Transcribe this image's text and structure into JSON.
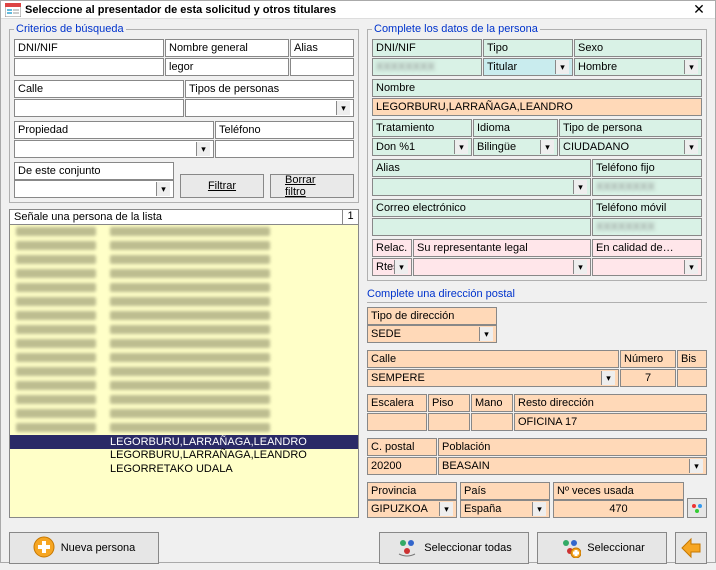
{
  "window": {
    "title": "Seleccione al presentador de esta solicitud y otros titulares"
  },
  "search": {
    "legend": "Criterios de búsqueda",
    "dni_lbl": "DNI/NIF",
    "dni_val": "",
    "nombre_lbl": "Nombre general",
    "nombre_val": "legor",
    "alias_lbl": "Alias",
    "alias_val": "",
    "calle_lbl": "Calle",
    "calle_val": "",
    "tipos_lbl": "Tipos de personas",
    "tipos_val": "",
    "propiedad_lbl": "Propiedad",
    "propiedad_val": "",
    "telefono_lbl": "Teléfono",
    "telefono_val": "",
    "conjunto_lbl": "De este conjunto",
    "conjunto_val": "",
    "filtrar": "Filtrar",
    "borrar": "Borrar filtro"
  },
  "list": {
    "header": "Señale una persona de la lista",
    "count": "1",
    "selected": "LEGORBURU,LARRAÑAGA,LEANDRO",
    "row2": "LEGORBURU,LARRAÑAGA,LEANDRO",
    "row3": "LEGORRETAKO UDALA"
  },
  "persona": {
    "legend": "Complete los datos de la persona",
    "dni_lbl": "DNI/NIF",
    "dni_val": "XXXXXXXX",
    "tipo_lbl": "Tipo",
    "tipo_val": "Titular",
    "sexo_lbl": "Sexo",
    "sexo_val": "Hombre",
    "nombre_lbl": "Nombre",
    "nombre_val": "LEGORBURU,LARRAÑAGA,LEANDRO",
    "trat_lbl": "Tratamiento",
    "trat_val": "Don %1",
    "idioma_lbl": "Idioma",
    "idioma_val": "Bilingüe",
    "tipop_lbl": "Tipo de persona",
    "tipop_val": "CIUDADANO",
    "alias_lbl": "Alias",
    "alias_val": "",
    "telf_lbl": "Teléfono fijo",
    "telf_val": "XXXXXXXX",
    "email_lbl": "Correo electrónico",
    "email_val": "",
    "telm_lbl": "Teléfono móvil",
    "telm_val": "XXXXXXXX",
    "relac_lbl": "Relac. Rtes.",
    "relac_val": "",
    "repr_lbl": "Su representante legal",
    "repr_val": "",
    "calidad_lbl": "En calidad de…",
    "calidad_val": ""
  },
  "direccion": {
    "header": "Complete una dirección postal",
    "tipo_lbl": "Tipo de dirección",
    "tipo_val": "SEDE",
    "calle_lbl": "Calle",
    "calle_val": "SEMPERE",
    "num_lbl": "Número",
    "num_val": "7",
    "bis_lbl": "Bis",
    "bis_val": "",
    "esc_lbl": "Escalera",
    "esc_val": "",
    "piso_lbl": "Piso",
    "piso_val": "",
    "mano_lbl": "Mano",
    "mano_val": "",
    "resto_lbl": "Resto dirección",
    "resto_val": "OFICINA 17",
    "cp_lbl": "C. postal",
    "cp_val": "20200",
    "pob_lbl": "Población",
    "pob_val": "BEASAIN",
    "prov_lbl": "Provincia",
    "prov_val": "GIPUZKOA",
    "pais_lbl": "País",
    "pais_val": "España",
    "veces_lbl": "Nº veces usada",
    "veces_val": "470"
  },
  "footer": {
    "nueva": "Nueva persona",
    "sel_todas": "Seleccionar todas",
    "seleccionar": "Seleccionar"
  }
}
